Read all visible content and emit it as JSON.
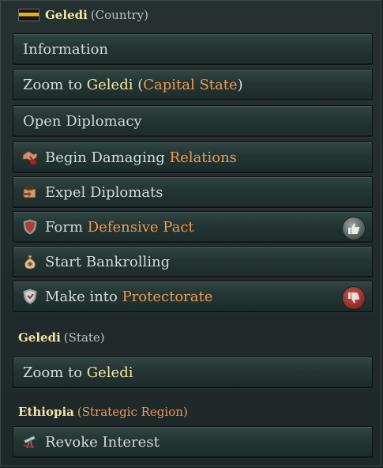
{
  "country": {
    "name": "Geledi",
    "qualifier": "(Country)",
    "flag_colors": [
      "#151515",
      "#e2b51b",
      "#151515"
    ]
  },
  "country_actions": [
    {
      "id": "information",
      "parts": [
        "Information"
      ]
    },
    {
      "id": "zoom-capital",
      "parts": [
        "Zoom to ",
        "Geledi",
        " (",
        "Capital State",
        ")"
      ]
    },
    {
      "id": "open-diplomacy",
      "parts": [
        "Open Diplomacy"
      ]
    },
    {
      "id": "damaging-relations",
      "parts": [
        "Begin Damaging ",
        "Relations"
      ]
    },
    {
      "id": "expel-diplomats",
      "parts": [
        "Expel Diplomats"
      ]
    },
    {
      "id": "defensive-pact",
      "parts": [
        "Form ",
        "Defensive Pact"
      ],
      "status": "thumbs-up-icon"
    },
    {
      "id": "bankrolling",
      "parts": [
        "Start Bankrolling"
      ]
    },
    {
      "id": "protectorate",
      "parts": [
        "Make into ",
        "Protectorate"
      ],
      "status": "thumbs-down-icon"
    }
  ],
  "state": {
    "name": "Geledi",
    "qualifier": "(State)",
    "action_parts": [
      "Zoom to ",
      "Geledi"
    ]
  },
  "region": {
    "name": "Ethiopia",
    "qualifier_open": "(",
    "qualifier": "Strategic Region",
    "qualifier_close": ")",
    "action": "Revoke Interest"
  },
  "colors": {
    "accent_yellow": "#f2e6a6",
    "accent_orange": "#ee9a55",
    "button_bg": "#233533",
    "text": "#d3dcd7"
  }
}
